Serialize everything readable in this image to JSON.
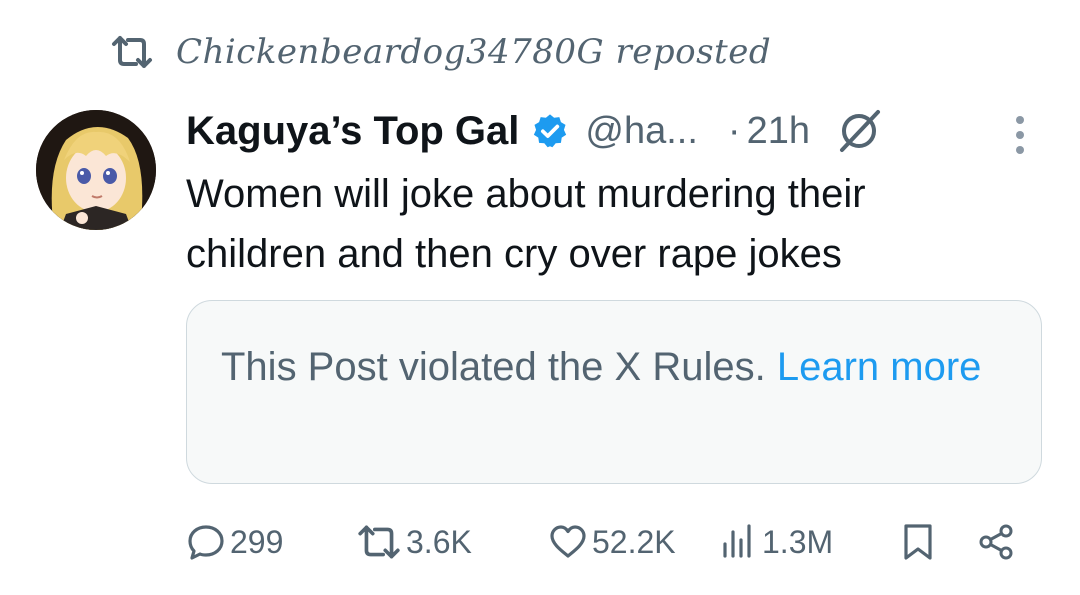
{
  "repost": {
    "icon": "repost-icon",
    "text": "Chickenbeardog34780G reposted"
  },
  "tweet": {
    "author_name": "Kaguya’s Top Gal",
    "verified_icon": "verified-badge-icon",
    "handle": "@ha...",
    "separator": "·",
    "time": "21h",
    "grok_icon": "grok-icon",
    "more_icon": "more-vertical-icon",
    "text": "Women will joke about murdering their children and then cry over rape jokes"
  },
  "notice": {
    "text": "This Post violated the X Rules.",
    "link": "Learn more"
  },
  "actions": {
    "replies": "299",
    "reposts": "3.6K",
    "likes": "52.2K",
    "views": "1.3M",
    "bookmark_icon": "bookmark-icon",
    "share_icon": "share-icon"
  },
  "colors": {
    "text_primary": "#0f1419",
    "text_secondary": "#536471",
    "accent": "#1d9bf0",
    "notice_bg": "#f7f9f9",
    "notice_border": "#cfd9de"
  }
}
